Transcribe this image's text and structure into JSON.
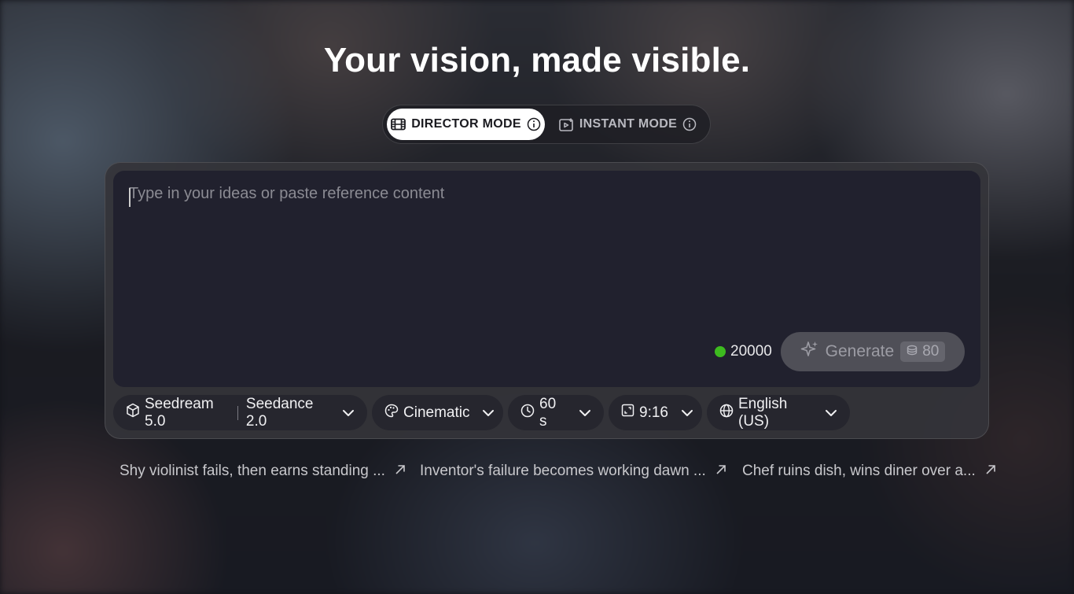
{
  "headline": "Your vision, made visible.",
  "modes": {
    "director": "DIRECTOR MODE",
    "instant": "INSTANT MODE"
  },
  "prompt": {
    "placeholder": "Type in your ideas or paste reference content",
    "value": ""
  },
  "credits": {
    "balance": "20000",
    "status_color": "#3dbb1f"
  },
  "generate": {
    "label": "Generate",
    "cost": "80"
  },
  "options": {
    "image_model": "Seedream 5.0",
    "video_model": "Seedance 2.0",
    "style": "Cinematic",
    "duration": "60 s",
    "aspect_ratio": "9:16",
    "language": "English (US)"
  },
  "suggestions": [
    "Shy violinist fails, then earns standing ...",
    "Inventor's failure becomes working dawn ...",
    "Chef ruins dish, wins diner over a..."
  ],
  "icons": {
    "director": "film-icon",
    "instant": "video-plus-icon",
    "info": "info-icon",
    "generate": "sparkle-icon",
    "cost": "coin-stack-icon",
    "model": "cube-icon",
    "style": "palette-icon",
    "duration": "clock-icon",
    "aspect": "aspect-ratio-icon",
    "language": "globe-icon",
    "suggestion": "arrow-up-right-icon"
  }
}
